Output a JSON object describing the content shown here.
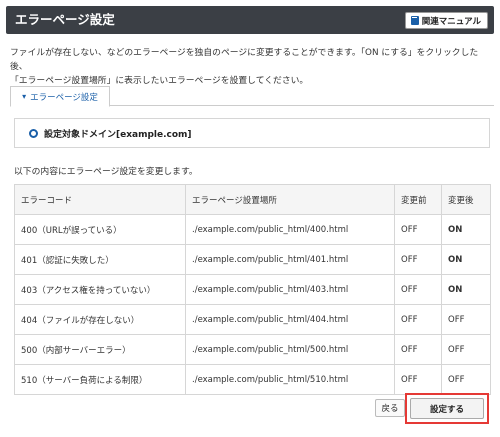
{
  "header": {
    "title": "エラーページ設定",
    "manual_label": "関連マニュアル",
    "manual_icon": "book-icon"
  },
  "description": {
    "line1": "ファイルが存在しない、などのエラーページを独自のページに変更することができます。「ON にする」をクリックした後、",
    "line2": "「エラーページ設置場所」に表示したいエラーページを設置してください。"
  },
  "tab": {
    "label": "エラーページ設定",
    "icon": "chevron-down-icon"
  },
  "domain": {
    "label": "設定対象ドメイン[example.com]"
  },
  "note": "以下の内容にエラーページ設定を変更します。",
  "table": {
    "headers": [
      "エラーコード",
      "エラーページ設置場所",
      "変更前",
      "変更後"
    ],
    "rows": [
      [
        "400（URLが誤っている）",
        "./example.com/public_html/400.html",
        "OFF",
        "ON"
      ],
      [
        "401（認証に失敗した）",
        "./example.com/public_html/401.html",
        "OFF",
        "ON"
      ],
      [
        "403（アクセス権を持っていない）",
        "./example.com/public_html/403.html",
        "OFF",
        "ON"
      ],
      [
        "404（ファイルが存在しない）",
        "./example.com/public_html/404.html",
        "OFF",
        "OFF"
      ],
      [
        "500（内部サーバーエラー）",
        "./example.com/public_html/500.html",
        "OFF",
        "OFF"
      ],
      [
        "510（サーバー負荷による制限）",
        "./example.com/public_html/510.html",
        "OFF",
        "OFF"
      ]
    ]
  },
  "buttons": {
    "back_label": "戻る",
    "submit_label": "設定する"
  },
  "colors": {
    "header_bg": "#3b3f45",
    "accent": "#1a5fa8",
    "highlight": "#e53935"
  }
}
